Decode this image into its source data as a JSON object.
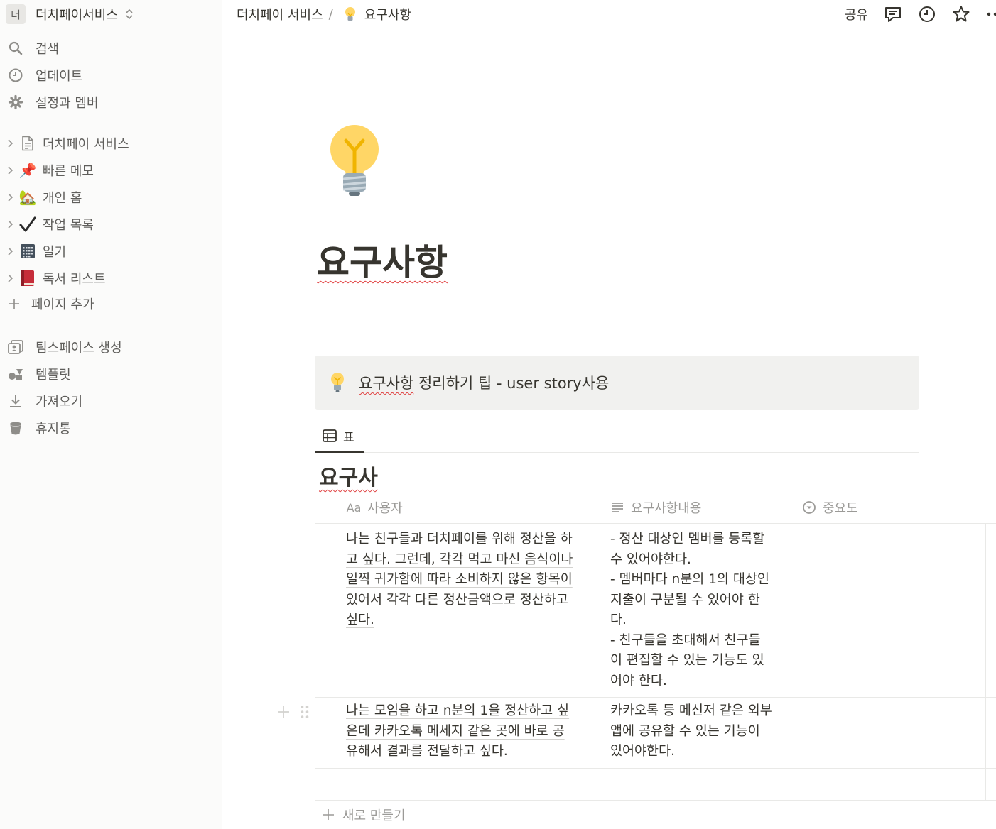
{
  "workspace": {
    "avatar_letter": "더",
    "name": "더치페이서비스"
  },
  "sidebar": {
    "nav": [
      {
        "label": "검색",
        "icon": "search-icon"
      },
      {
        "label": "업데이트",
        "icon": "clock-icon"
      },
      {
        "label": "설정과 멤버",
        "icon": "gear-icon"
      }
    ],
    "pages": [
      {
        "label": "더치페이 서비스",
        "icon": "document-icon"
      },
      {
        "label": "빠른 메모",
        "icon": "pushpin-emoji",
        "glyph": "📌"
      },
      {
        "label": "개인 홈",
        "icon": "house-emoji",
        "glyph": "🏡"
      },
      {
        "label": "작업 목록",
        "icon": "checkmark-emoji",
        "glyph": "✔"
      },
      {
        "label": "일기",
        "icon": "calendar-emoji",
        "glyph": "▦"
      },
      {
        "label": "독서 리스트",
        "icon": "book-emoji",
        "glyph": "📕"
      }
    ],
    "add_page": "페이지 추가",
    "bottom": [
      {
        "label": "팀스페이스 생성",
        "icon": "teamspace-icon"
      },
      {
        "label": "템플릿",
        "icon": "shapes-icon"
      },
      {
        "label": "가져오기",
        "icon": "download-icon"
      },
      {
        "label": "휴지통",
        "icon": "trash-icon"
      }
    ]
  },
  "topbar": {
    "breadcrumb_parent": "더치페이 서비스",
    "breadcrumb_sep": "/",
    "breadcrumb_current": "요구사항",
    "share_label": "공유"
  },
  "page": {
    "icon": "lightbulb-emoji",
    "title": "요구사항",
    "callout": {
      "icon": "lightbulb-emoji",
      "text_wavy": "요구사항",
      "text_rest": " 정리하기 팁 - user story사용"
    },
    "view_tab": "표",
    "db_title": "요구사"
  },
  "table": {
    "columns": [
      {
        "label": "사용자",
        "icon": "title-icon",
        "icon_text": "Aa"
      },
      {
        "label": "요구사항내용",
        "icon": "text-lines-icon"
      },
      {
        "label": "중요도",
        "icon": "select-icon"
      }
    ],
    "rows": [
      {
        "name_lines": [
          "나는 친구들과 더치페이를 위해 정산을 하",
          "고 싶다. 그런데, 각각 먹고 마신 음식이나",
          "일찍 귀가함에 따라 소비하지 않은 항목이",
          "있어서 각각 다른 정산금액으로 정산하고",
          "싶다."
        ],
        "content_lines": [
          "- 정산 대상인 멤버를 등록할",
          "수 있어야한다.",
          "- 멤버마다 n분의 1의 대상인",
          "지출이 구분될 수 있어야 한",
          "다.",
          "- 친구들을 초대해서 친구들",
          "이 편집할 수 있는 기능도 있",
          "어야 한다."
        ],
        "importance": ""
      },
      {
        "name_lines": [
          "나는 모임을 하고 n분의 1을 정산하고 싶",
          "은데 카카오톡 메세지 같은 곳에 바로 공",
          "유해서 결과를 전달하고 싶다."
        ],
        "content_lines": [
          "카카오톡 등 메신저 같은 외부",
          "앱에 공유할 수 있는 기능이",
          "있어야한다."
        ],
        "importance": ""
      }
    ],
    "new_row_label": "새로 만들기"
  }
}
